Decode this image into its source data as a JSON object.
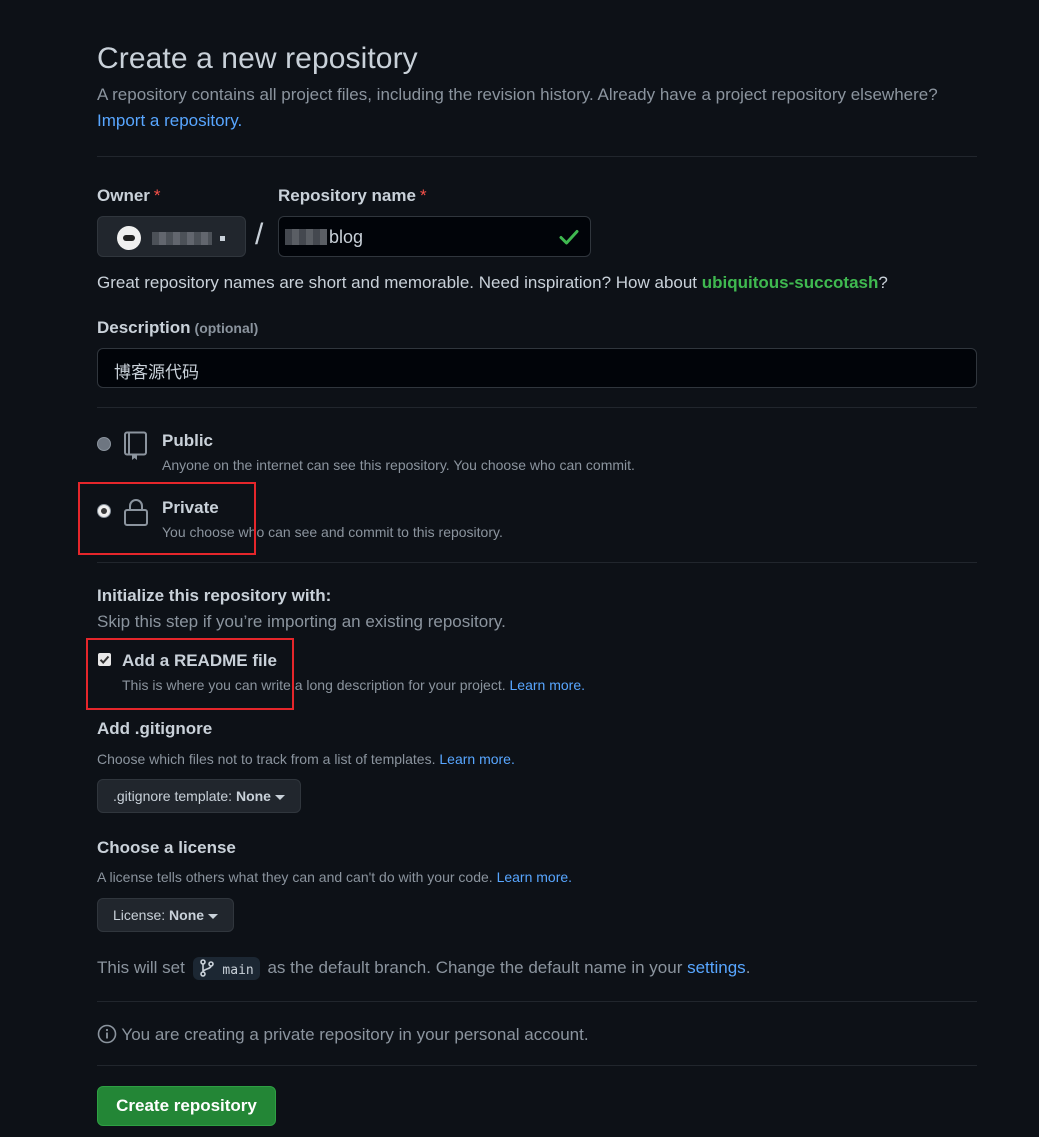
{
  "header": {
    "title": "Create a new repository",
    "subtitle": "A repository contains all project files, including the revision history. Already have a project repository elsewhere?",
    "import_link": "Import a repository."
  },
  "owner": {
    "label": "Owner",
    "required_mark": "*"
  },
  "repo_name": {
    "label": "Repository name",
    "required_mark": "*",
    "value": "blog"
  },
  "name_hint": {
    "text": "Great repository names are short and memorable. Need inspiration? How about ",
    "suggestion": "ubiquitous-succotash",
    "suffix": "?"
  },
  "description": {
    "label": "Description",
    "optional": "(optional)",
    "value": "博客源代码"
  },
  "visibility": {
    "selected": "private",
    "public": {
      "title": "Public",
      "desc": "Anyone on the internet can see this repository. You choose who can commit."
    },
    "private": {
      "title": "Private",
      "desc": "You choose who can see and commit to this repository."
    }
  },
  "init": {
    "title": "Initialize this repository with:",
    "subtitle": "Skip this step if you’re importing an existing repository.",
    "readme": {
      "checked": true,
      "label": "Add a README file",
      "desc": "This is where you can write a long description for your project.",
      "learn_more": "Learn more."
    },
    "gitignore": {
      "title": "Add .gitignore",
      "desc": "Choose which files not to track from a list of templates.",
      "learn_more": "Learn more.",
      "button_prefix": ".gitignore template:",
      "button_value": "None"
    },
    "license": {
      "title": "Choose a license",
      "desc": "A license tells others what they can and can't do with your code.",
      "learn_more": "Learn more.",
      "button_prefix": "License:",
      "button_value": "None"
    }
  },
  "branch": {
    "prefix": "This will set",
    "name": "main",
    "middle": "as the default branch. Change the default name in your",
    "settings_link": "settings",
    "suffix": "."
  },
  "notice": "You are creating a private repository in your personal account.",
  "submit_label": "Create repository",
  "colors": {
    "background": "#0d1117",
    "link": "#58a6ff",
    "success": "#3fb950",
    "primary_button": "#238636",
    "annotation": "#e5262b"
  }
}
